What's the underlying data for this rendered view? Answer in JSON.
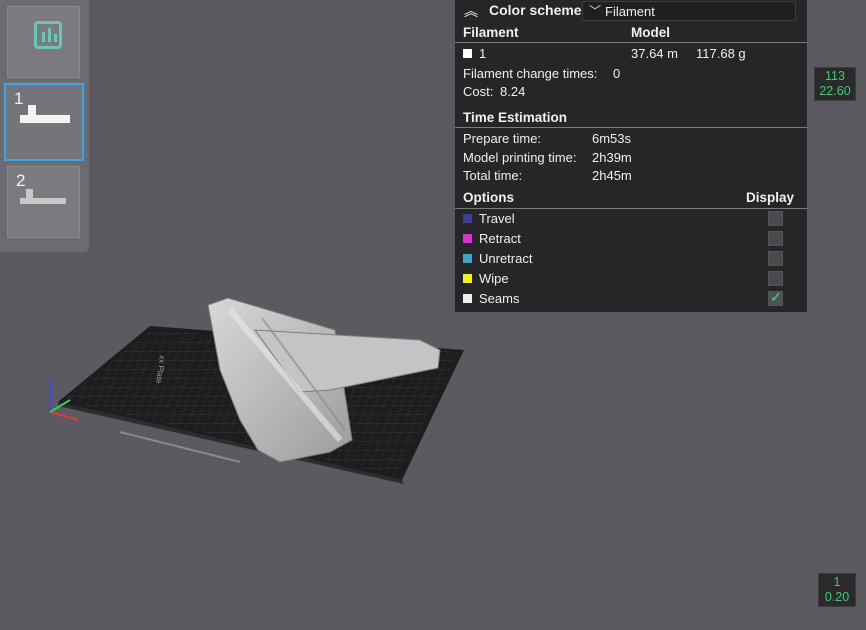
{
  "plates": [
    {
      "number": "1"
    },
    {
      "number": "2"
    }
  ],
  "legend": {
    "color_scheme_label": "Color scheme",
    "color_scheme_value": "Filament",
    "filament_header": "Filament",
    "model_header": "Model",
    "filament_row": {
      "id": "1",
      "length": "37.64 m",
      "weight": "117.68 g",
      "color": "#ffffff"
    },
    "filament_change_times_label": "Filament change times:",
    "filament_change_times_value": "0",
    "cost_label": "Cost:",
    "cost_value": "8.24",
    "time_estimation_title": "Time Estimation",
    "prepare_time_label": "Prepare time:",
    "prepare_time_value": "6m53s",
    "model_printing_time_label": "Model printing time:",
    "model_printing_time_value": "2h39m",
    "total_time_label": "Total time:",
    "total_time_value": "2h45m",
    "options_title": "Options",
    "display_title": "Display",
    "options": [
      {
        "label": "Travel",
        "color": "#3c3f9c",
        "checked": false
      },
      {
        "label": "Retract",
        "color": "#d632d6",
        "checked": false
      },
      {
        "label": "Unretract",
        "color": "#3aa6cf",
        "checked": false
      },
      {
        "label": "Wipe",
        "color": "#f2f20e",
        "checked": false
      },
      {
        "label": "Seams",
        "color": "#eeeeee",
        "checked": true
      }
    ]
  },
  "layer_slider": {
    "top_layer": "113",
    "top_height": "22.60",
    "bottom_layer": "1",
    "bottom_height": "0.20"
  },
  "colors": {
    "background": "#5b5a60",
    "panel": "#262629",
    "accent_green": "#37d06b",
    "selection_blue": "#3aa6e8"
  }
}
